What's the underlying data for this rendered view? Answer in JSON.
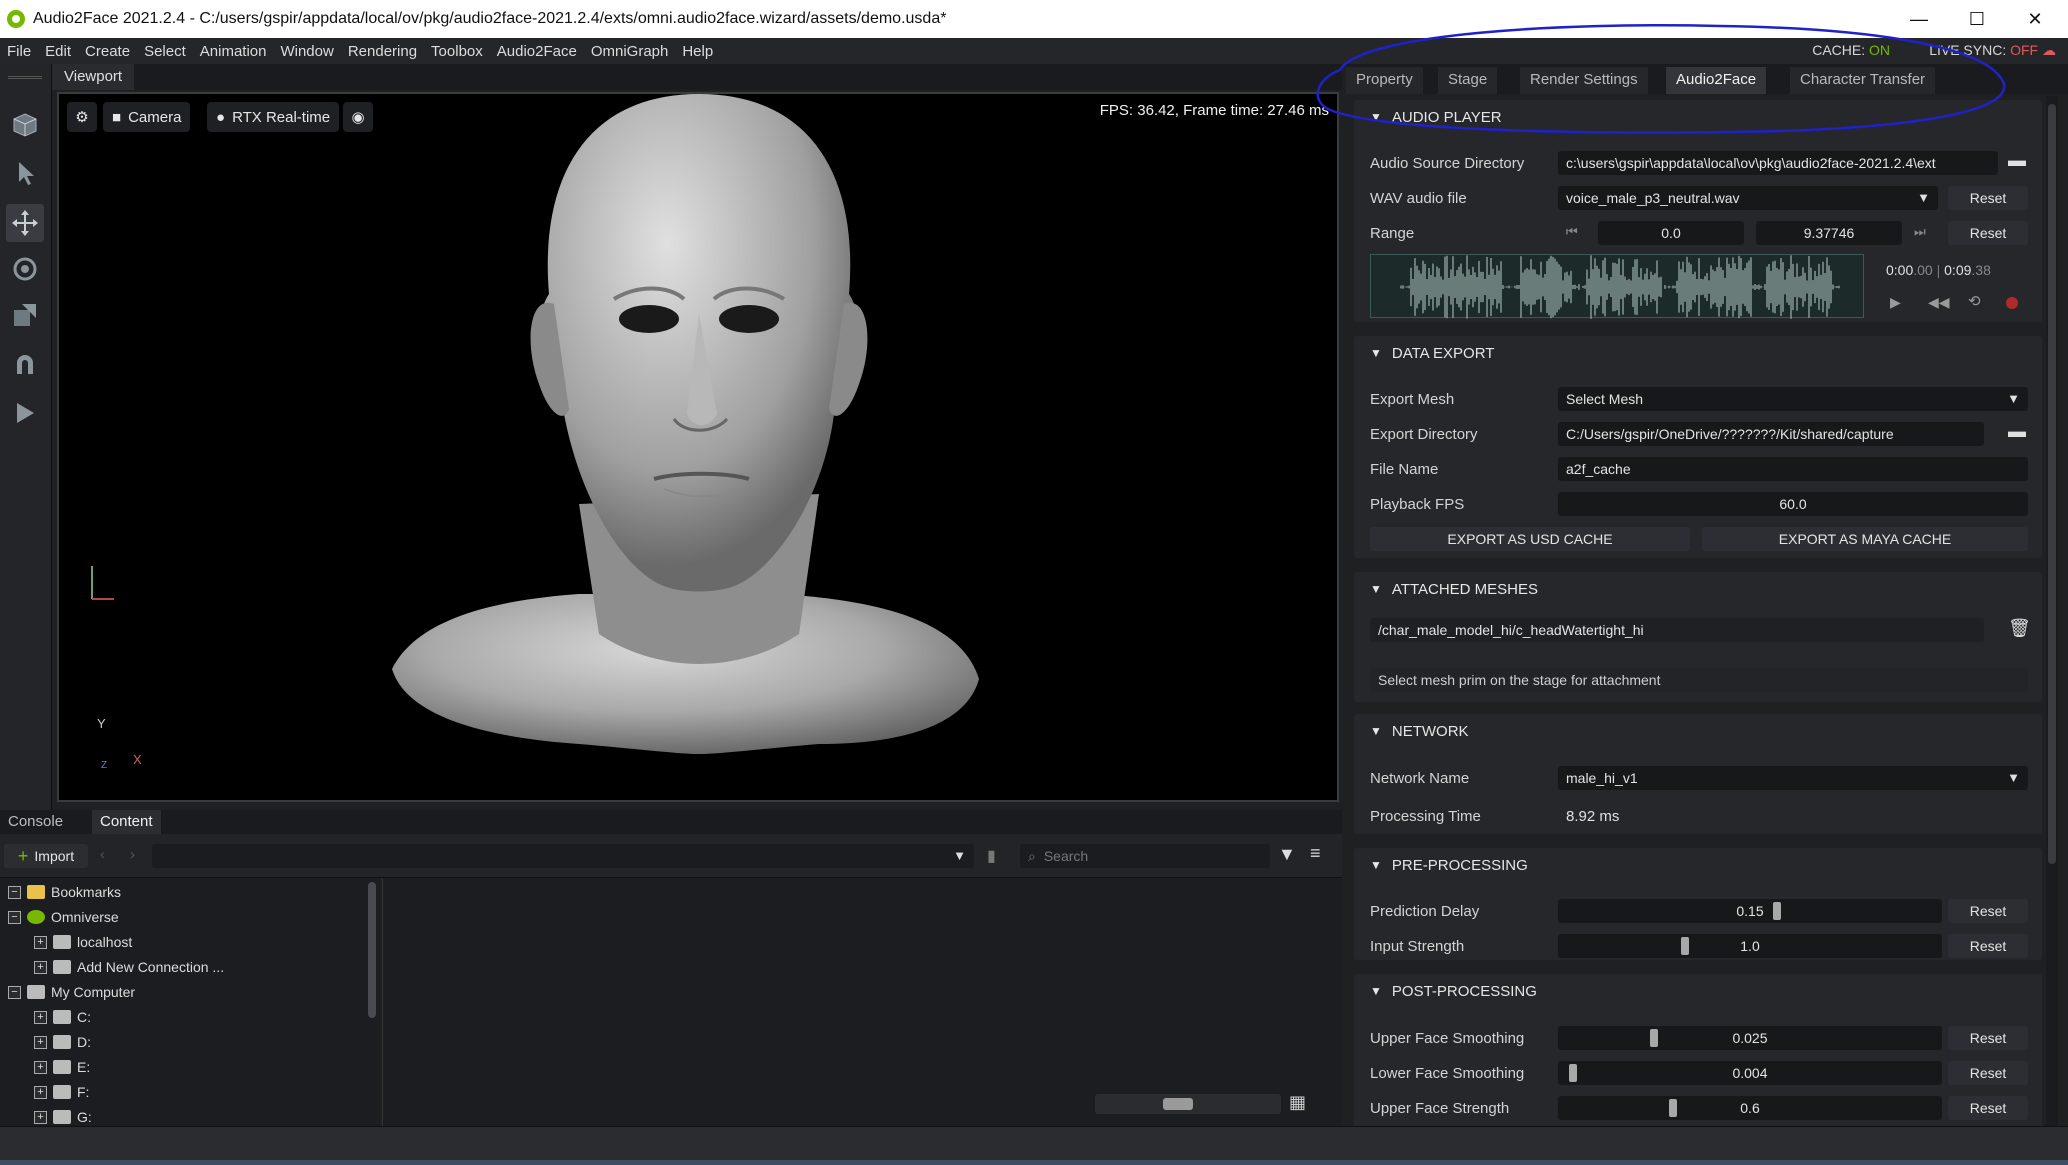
{
  "window": {
    "title": "Audio2Face 2021.2.4 - C:/users/gspir/appdata/local/ov/pkg/audio2face-2021.2.4/exts/omni.audio2face.wizard/assets/demo.usda*",
    "minimize": "—",
    "maximize": "☐",
    "close": "✕"
  },
  "menubar": {
    "items": [
      "File",
      "Edit",
      "Create",
      "Select",
      "Animation",
      "Window",
      "Rendering",
      "Toolbox",
      "Audio2Face",
      "OmniGraph",
      "Help"
    ],
    "cache_label": "CACHE:",
    "cache_value": "ON",
    "livesync_label": "LIVE SYNC:",
    "livesync_value": "OFF"
  },
  "viewport": {
    "tab": "Viewport",
    "camera": "Camera",
    "renderer": "RTX Real-time",
    "fps": "FPS: 36.42, Frame time: 27.46 ms",
    "axis_y": "Y",
    "axis_x": "X",
    "axis_z": "Z"
  },
  "bottom": {
    "tabs": [
      "Console",
      "Content"
    ],
    "import": "Import",
    "search_placeholder": "Search",
    "tree": [
      {
        "label": "Bookmarks",
        "indent": 0,
        "icon": "bookmark-icon"
      },
      {
        "label": "Omniverse",
        "indent": 0,
        "icon": "omniverse-icon"
      },
      {
        "label": "localhost",
        "indent": 1,
        "icon": "server-icon"
      },
      {
        "label": "Add New Connection ...",
        "indent": 1,
        "icon": "server-add-icon"
      },
      {
        "label": "My Computer",
        "indent": 0,
        "icon": "computer-icon"
      },
      {
        "label": "C:",
        "indent": 1,
        "icon": "drive-icon"
      },
      {
        "label": "D:",
        "indent": 1,
        "icon": "drive-icon"
      },
      {
        "label": "E:",
        "indent": 1,
        "icon": "drive-icon"
      },
      {
        "label": "F:",
        "indent": 1,
        "icon": "drive-icon"
      },
      {
        "label": "G:",
        "indent": 1,
        "icon": "drive-icon"
      }
    ]
  },
  "panel": {
    "tabs": [
      "Property",
      "Stage",
      "Render Settings",
      "Audio2Face",
      "Character Transfer"
    ],
    "active_tab": "Audio2Face",
    "audio_player": {
      "title": "AUDIO PLAYER",
      "source_dir_label": "Audio Source Directory",
      "source_dir_value": "c:\\users\\gspir\\appdata\\local\\ov\\pkg\\audio2face-2021.2.4\\ext",
      "wav_label": "WAV audio file",
      "wav_value": "voice_male_p3_neutral.wav",
      "range_label": "Range",
      "range_start": "0.0",
      "range_end": "9.37746",
      "reset": "Reset",
      "time_current": "0:00",
      "time_current_frac": ".00",
      "time_sep": "|",
      "time_total": "0:09",
      "time_total_frac": ".38"
    },
    "data_export": {
      "title": "DATA EXPORT",
      "mesh_label": "Export Mesh",
      "mesh_value": "Select Mesh",
      "dir_label": "Export Directory",
      "dir_value": "C:/Users/gspir/OneDrive/???????/Kit/shared/capture",
      "file_label": "File Name",
      "file_value": "a2f_cache",
      "fps_label": "Playback FPS",
      "fps_value": "60.0",
      "usd_btn": "EXPORT AS USD CACHE",
      "maya_btn": "EXPORT AS MAYA CACHE"
    },
    "attached_meshes": {
      "title": "ATTACHED MESHES",
      "mesh_path": "/char_male_model_hi/c_headWatertight_hi",
      "hint": "Select mesh prim on the stage for attachment"
    },
    "network": {
      "title": "NETWORK",
      "name_label": "Network Name",
      "name_value": "male_hi_v1",
      "time_label": "Processing Time",
      "time_value": "8.92 ms"
    },
    "pre_processing": {
      "title": "PRE-PROCESSING",
      "delay_label": "Prediction Delay",
      "delay_value": "0.15",
      "delay_level": 0.57,
      "strength_label": "Input Strength",
      "strength_value": "1.0",
      "strength_level": 0.33
    },
    "post_processing": {
      "title": "POST-PROCESSING",
      "upper_smooth_label": "Upper Face Smoothing",
      "upper_smooth_value": "0.025",
      "upper_smooth_level": 0.25,
      "lower_smooth_label": "Lower Face Smoothing",
      "lower_smooth_value": "0.004",
      "lower_smooth_level": 0.04,
      "upper_strength_label": "Upper Face Strength",
      "upper_strength_value": "0.6",
      "upper_strength_level": 0.3
    }
  },
  "colors": {
    "accent_green": "#76b900",
    "off_red": "#e05a5a",
    "annotation_blue": "#1f22c8",
    "waveform": "#9fb4ae"
  }
}
